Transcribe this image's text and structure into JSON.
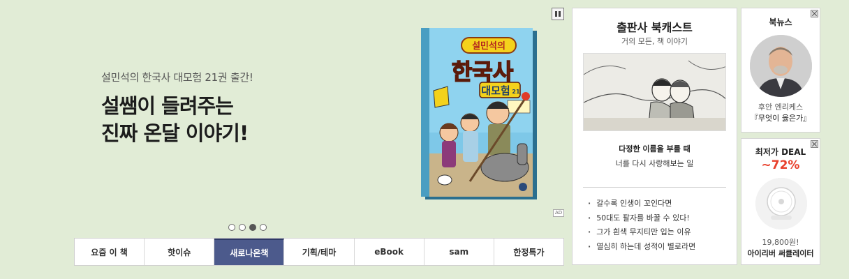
{
  "hero": {
    "subtitle": "설민석의 한국사 대모험 21권 출간!",
    "title_line1": "설쌤이 들려주는",
    "title_line2": "진짜 온달 이야기!",
    "ad_label": "AD",
    "book": {
      "top_title": "설민석의",
      "main_title": "한국사",
      "series": "대모험",
      "volume": "21"
    },
    "slides": {
      "total": 4,
      "current": 3
    }
  },
  "tabs": [
    {
      "label": "요즘 이 책",
      "active": false
    },
    {
      "label": "핫이슈",
      "active": false
    },
    {
      "label": "새로나온책",
      "active": true
    },
    {
      "label": "기획/테마",
      "active": false
    },
    {
      "label": "eBook",
      "active": false
    },
    {
      "label": "sam",
      "active": false
    },
    {
      "label": "한정특가",
      "active": false
    }
  ],
  "podcast": {
    "title": "출판사 북캐스트",
    "subtitle": "거의 모든, 책 이야기",
    "caption_bold": "다정한 이름을 부를 때",
    "caption": "너를 다시 사랑해보는 일",
    "list": [
      "갈수록 인생이 꼬인다면",
      "50대도 팔자를 바꿀 수 있다!",
      "그가 흰색 무지티만 입는 이유",
      "열심히 하는데 성적이 별로라면"
    ]
  },
  "news": {
    "title": "북뉴스",
    "author": "후안 엔리케스",
    "book": "『무엇이 옳은가』"
  },
  "deal": {
    "title": "최저가 DEAL",
    "discount": "~72%",
    "price": "19,800원!",
    "product": "아이리버 써큘레이터"
  },
  "colors": {
    "background": "#e1ecd6",
    "active_tab": "#4c5a8c",
    "discount": "#e8402c"
  }
}
